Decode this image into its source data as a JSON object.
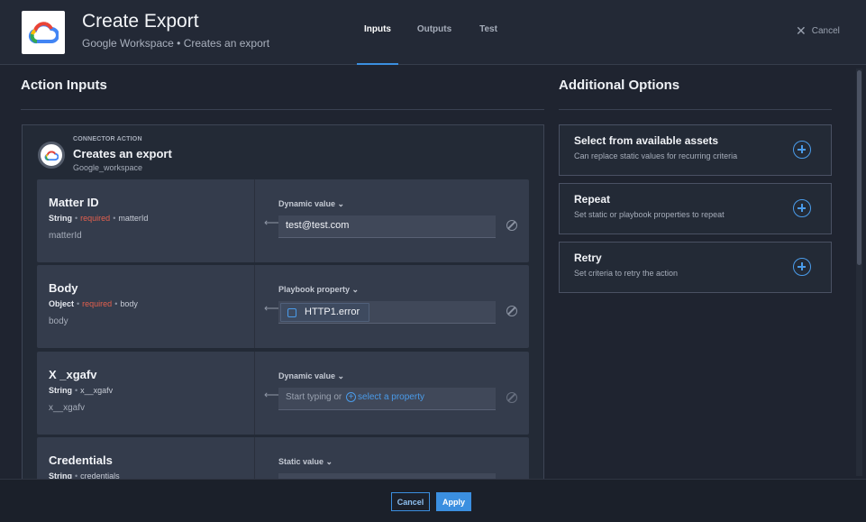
{
  "header": {
    "title": "Create Export",
    "subtitle": "Google Workspace • Creates an export",
    "tabs": [
      {
        "label": "Inputs",
        "active": true
      },
      {
        "label": "Outputs",
        "active": false
      },
      {
        "label": "Test",
        "active": false
      }
    ],
    "cancel_label": "Cancel",
    "logo_icon": "google-cloud-icon"
  },
  "action_inputs": {
    "heading": "Action Inputs",
    "connector": {
      "kicker": "CONNECTOR ACTION",
      "title": "Creates an export",
      "subtitle": "Google_workspace"
    },
    "fields": [
      {
        "name": "Matter ID",
        "type": "String",
        "required": "required",
        "key_inline": "matterId",
        "key": "matterId",
        "mode": "Dynamic value ⌄",
        "value": "test@test.com"
      },
      {
        "name": "Body",
        "type": "Object",
        "required": "required",
        "key_inline": "body",
        "key": "body",
        "mode": "Playbook property ⌄",
        "chip": "HTTP1.error"
      },
      {
        "name": "X _xgafv",
        "type": "String",
        "key_inline": "x__xgafv",
        "key": "x__xgafv",
        "mode": "Dynamic value ⌄",
        "placeholder_prefix": "Start typing or",
        "placeholder_link": "select a property"
      },
      {
        "name": "Credentials",
        "type": "String",
        "key_inline": "credentials",
        "mode": "Static value ⌄"
      }
    ]
  },
  "additional_options": {
    "heading": "Additional Options",
    "items": [
      {
        "title": "Select from available assets",
        "description": "Can replace static values for recurring criteria"
      },
      {
        "title": "Repeat",
        "description": "Set static or playbook properties to repeat"
      },
      {
        "title": "Retry",
        "description": "Set criteria to retry the action"
      }
    ]
  },
  "footer": {
    "cancel_label": "Cancel",
    "apply_label": "Apply"
  },
  "colors": {
    "accent": "#3b8fe0",
    "required": "#e3604e",
    "background": "#1f2430"
  }
}
